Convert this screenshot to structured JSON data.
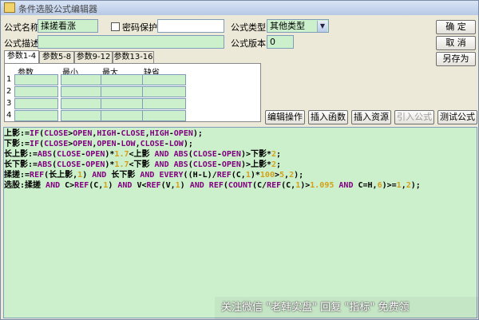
{
  "window": {
    "title": "条件选股公式编辑器"
  },
  "form": {
    "name_label": "公式名称",
    "name_value": "揉搓看涨",
    "password_label": "密码保护",
    "type_label": "公式类型",
    "type_value": "其他类型",
    "desc_label": "公式描述",
    "desc_value": "",
    "version_label": "公式版本",
    "version_value": "0"
  },
  "buttons": {
    "ok": "确  定",
    "cancel": "取  消",
    "save_as": "另存为",
    "edit_op": "编辑操作",
    "insert_func": "插入函数",
    "insert_res": "插入资源",
    "import_formula": "引入公式",
    "test_formula": "测试公式"
  },
  "tabs": [
    "参数1-4",
    "参数5-8",
    "参数9-12",
    "参数13-16"
  ],
  "params": {
    "headers": [
      "参数",
      "最小",
      "最大",
      "缺省"
    ],
    "rows": [
      "1",
      "2",
      "3",
      "4"
    ]
  },
  "code_colors": {
    "text": "#000000",
    "keyword": "#800080",
    "number": "#d4a017",
    "background": "#ccf0cc"
  },
  "code_lines": [
    "上影:=IF(CLOSE>OPEN,HIGH-CLOSE,HIGH-OPEN);",
    "下影:=IF(CLOSE>OPEN,OPEN-LOW,CLOSE-LOW);",
    "长上影:=ABS(CLOSE-OPEN)*1.7<上影 AND ABS(CLOSE-OPEN)>下影*2;",
    "长下影:=ABS(CLOSE-OPEN)*1.7<下影 AND ABS(CLOSE-OPEN)>上影*2;",
    "揉搓:=REF(长上影,1) AND 长下影 AND EVERY((H-L)/REF(C,1)*100>5,2);",
    "选股:揉搓 AND C>REF(C,1) AND V<REF(V,1) AND REF(COUNT(C/REF(C,1)>1.095 AND C=H,6)>=1,2);"
  ],
  "watermark": "关注微信 \"老韩实盘\" 回复 \"指标\" 免费领"
}
